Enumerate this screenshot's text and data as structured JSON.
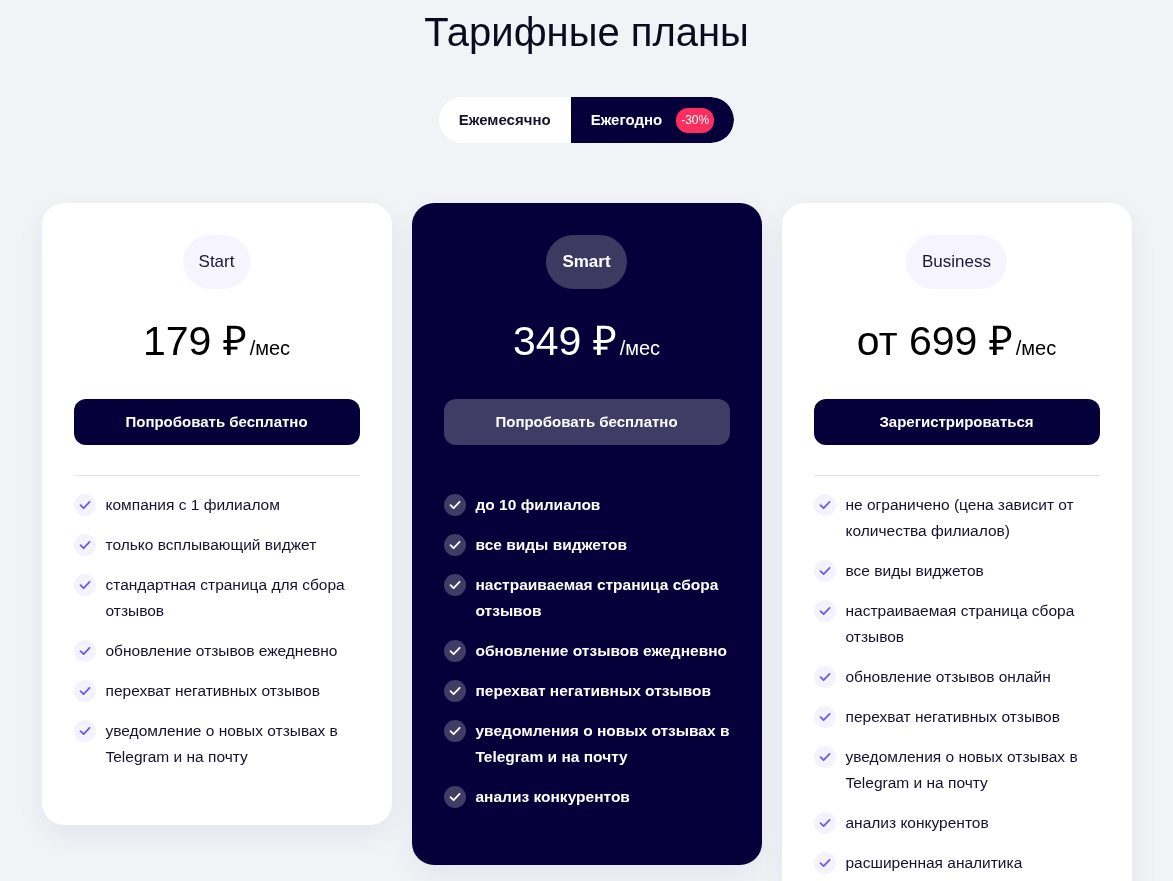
{
  "title": "Тарифные планы",
  "billing_toggle": [
    {
      "label": "Ежемесячно",
      "selected": false
    },
    {
      "label": "Ежегодно",
      "selected": true,
      "badge": "-30%"
    }
  ],
  "plans": [
    {
      "name": "Start",
      "featured": false,
      "price": "179 ₽",
      "period": "/мес",
      "button": "Попробовать бесплатно",
      "features": [
        "компания с 1 филиалом",
        "только всплывающий виджет",
        "стандартная страница для сбора отзывов",
        "обновление отзывов ежедневно",
        "перехват негативных отзывов",
        "уведомление о новых отзывах в Telegram и на почту"
      ]
    },
    {
      "name": "Smart",
      "featured": true,
      "price": "349 ₽",
      "period": "/мес",
      "button": "Попробовать бесплатно",
      "features": [
        "до 10 филиалов",
        "все виды виджетов",
        "настраиваемая страница сбора отзывов",
        "обновление отзывов ежедневно",
        "перехват негативных отзывов",
        "уведомления о новых отзывах в Telegram и на почту",
        "анализ конкурентов"
      ]
    },
    {
      "name": "Business",
      "featured": false,
      "price": "от 699 ₽",
      "period": "/мес",
      "button": "Зарегистрироваться",
      "features": [
        "не ограничено (цена зависит от количества филиалов)",
        "все виды виджетов",
        "настраиваемая страница сбора отзывов",
        "обновление отзывов онлайн",
        "перехват негативных отзывов",
        "уведомления о новых отзывах в Telegram и на почту",
        "анализ конкурентов",
        "расширенная аналитика"
      ]
    }
  ]
}
